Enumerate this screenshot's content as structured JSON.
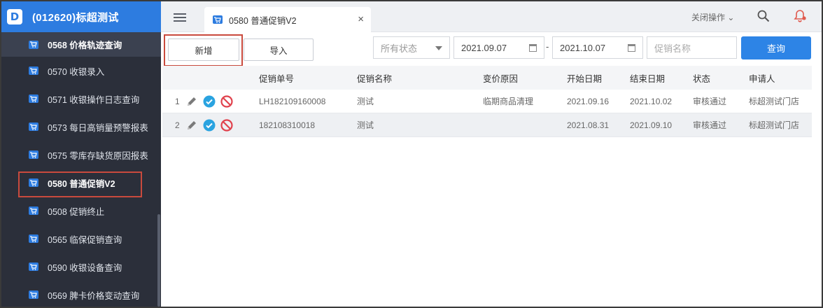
{
  "app": {
    "title": "(012620)标超测试",
    "logo_letter": "D"
  },
  "sidebar": {
    "items": [
      {
        "label": "0568 价格轨迹查询"
      },
      {
        "label": "0570 收银录入"
      },
      {
        "label": "0571 收银操作日志查询"
      },
      {
        "label": "0573 每日高销量预警报表"
      },
      {
        "label": "0575 零库存缺货原因报表"
      },
      {
        "label": "0580 普通促销V2"
      },
      {
        "label": "0508 促销终止"
      },
      {
        "label": "0565 临保促销查询"
      },
      {
        "label": "0590 收银设备查询"
      },
      {
        "label": "0569 脾卡价格变动查询"
      }
    ]
  },
  "topbar": {
    "tab_label": "0580 普通促销V2",
    "tab_close": "×",
    "close_ops": "关闭操作 ⌄"
  },
  "toolbar": {
    "add_label": "新增",
    "import_label": "导入",
    "status_value": "所有状态",
    "start_date": "2021.09.07",
    "date_sep": "-",
    "end_date": "2021.10.07",
    "name_placeholder": "促销名称",
    "query_label": "查询"
  },
  "table": {
    "headers": [
      "促销单号",
      "促销名称",
      "变价原因",
      "开始日期",
      "结束日期",
      "状态",
      "申请人"
    ],
    "rows": [
      {
        "num": "1",
        "id": "LH182109160008",
        "name": "测试",
        "reason": "临期商品清理",
        "start": "2021.09.16",
        "end": "2021.10.02",
        "status": "审核通过",
        "applicant": "标超测试门店"
      },
      {
        "num": "2",
        "id": "182108310018",
        "name": "测试",
        "reason": "",
        "start": "2021.08.31",
        "end": "2021.09.10",
        "status": "审核通过",
        "applicant": "标超测试门店"
      }
    ]
  },
  "colors": {
    "accent": "#2d7ce0",
    "sidebar_bg": "#2b2f3a",
    "highlight": "#c94a3d"
  }
}
